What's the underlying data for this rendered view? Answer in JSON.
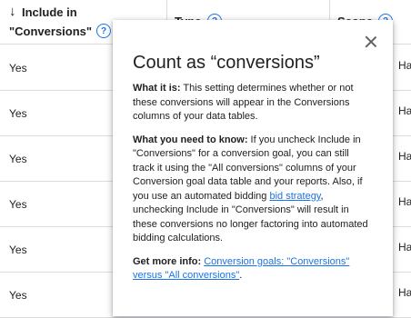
{
  "table": {
    "headers": {
      "include": {
        "line1": "Include in",
        "line2": "\"Conversions\"",
        "arrow": "↓"
      },
      "type": "Type",
      "scope": "Scope"
    },
    "rows": [
      {
        "include": "Yes",
        "scope": "Ha"
      },
      {
        "include": "Yes",
        "scope": "Ha"
      },
      {
        "include": "Yes",
        "scope": "Ha"
      },
      {
        "include": "Yes",
        "scope": "Ha"
      },
      {
        "include": "Yes",
        "scope": "Ha"
      },
      {
        "include": "Yes",
        "scope": "Ha"
      }
    ],
    "help_glyph": "?"
  },
  "popup": {
    "title": "Count as “conversions”",
    "what_label": "What it is:",
    "what_text": " This setting determines whether or not these conversions will appear in the Conversions columns of your data tables.",
    "need_label": "What you need to know:",
    "need_text_1": " If you uncheck Include in \"Conversions\" for a conversion goal, you can still track it using the \"All conversions\" columns of your Conversion goal data table and your reports. Also, if you use an automated bidding ",
    "need_link": "bid strategy",
    "need_text_2": ", unchecking Include in \"Conversions\" will result in these conversions no longer factoring into automated bidding calculations.",
    "more_label": "Get more info:",
    "more_link": "Conversion goals: \"Conversions\" versus \"All conversions\"",
    "more_end": "."
  }
}
